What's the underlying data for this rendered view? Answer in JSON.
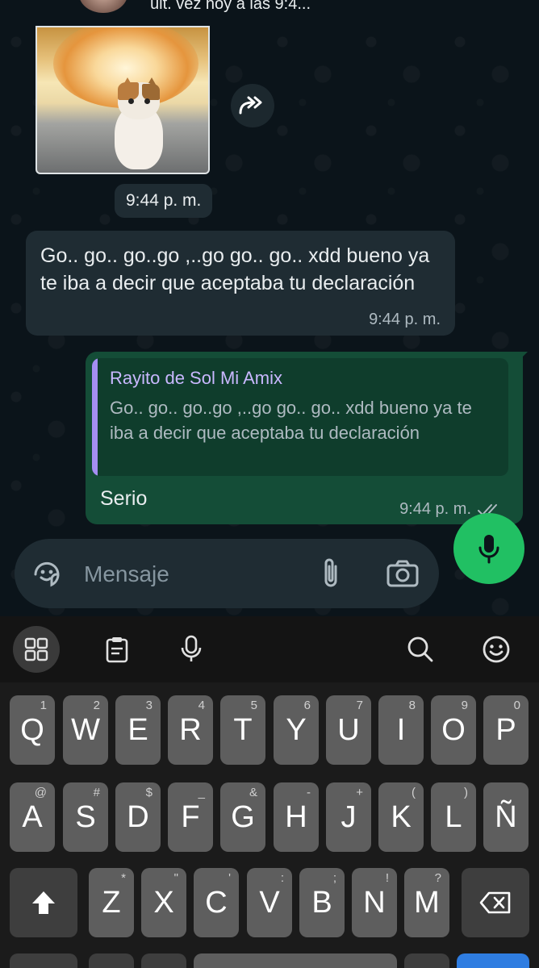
{
  "header": {
    "last_seen": "últ. vez hoy a las 9:4..."
  },
  "messages": {
    "image_time": "9:44 p. m.",
    "incoming": {
      "text": "Go.. go.. go..go ,..go go.. go.. xdd bueno ya te iba a decir que aceptaba tu declaración",
      "time": "9:44 p. m."
    },
    "outgoing": {
      "reply_name": "Rayito de Sol Mi Amix",
      "reply_text": "Go.. go.. go..go ,..go go.. go.. xdd bueno ya te iba a decir que aceptaba tu declaración",
      "text": "Serio",
      "time": "9:44 p. m.",
      "status": "read"
    }
  },
  "composer": {
    "placeholder": "Mensaje"
  },
  "keyboard": {
    "toolbar_icons": [
      "apps-icon",
      "clipboard-icon",
      "voice-input-icon",
      "search-icon",
      "emoji-icon"
    ],
    "row1": [
      {
        "key": "Q",
        "hint": "1"
      },
      {
        "key": "W",
        "hint": "2"
      },
      {
        "key": "E",
        "hint": "3"
      },
      {
        "key": "R",
        "hint": "4"
      },
      {
        "key": "T",
        "hint": "5"
      },
      {
        "key": "Y",
        "hint": "6"
      },
      {
        "key": "U",
        "hint": "7"
      },
      {
        "key": "I",
        "hint": "8"
      },
      {
        "key": "O",
        "hint": "9"
      },
      {
        "key": "P",
        "hint": "0"
      }
    ],
    "row2": [
      {
        "key": "A",
        "hint": "@"
      },
      {
        "key": "S",
        "hint": "#"
      },
      {
        "key": "D",
        "hint": "$"
      },
      {
        "key": "F",
        "hint": "_"
      },
      {
        "key": "G",
        "hint": "&"
      },
      {
        "key": "H",
        "hint": "-"
      },
      {
        "key": "J",
        "hint": "+"
      },
      {
        "key": "K",
        "hint": "("
      },
      {
        "key": "L",
        "hint": ")"
      },
      {
        "key": "Ñ",
        "hint": ""
      }
    ],
    "row3": [
      {
        "key": "Z",
        "hint": "*"
      },
      {
        "key": "X",
        "hint": "\""
      },
      {
        "key": "C",
        "hint": "'"
      },
      {
        "key": "V",
        "hint": ":"
      },
      {
        "key": "B",
        "hint": ";"
      },
      {
        "key": "N",
        "hint": "!"
      },
      {
        "key": "M",
        "hint": "?"
      }
    ]
  },
  "colors": {
    "accent": "#21c063",
    "outgoing_bubble": "#144d37",
    "incoming_bubble": "#1f2c33",
    "reply_name": "#c9b8ff"
  }
}
